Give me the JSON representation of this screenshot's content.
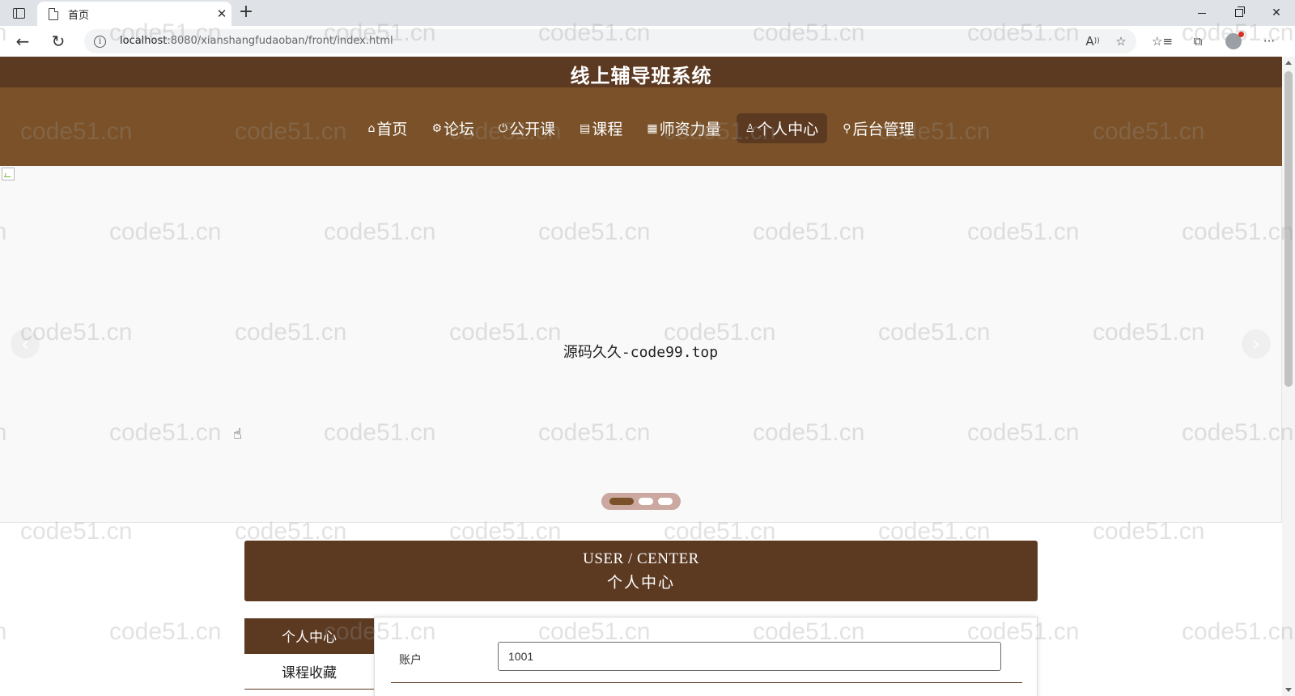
{
  "browser": {
    "tab_title": "首页",
    "url_host": "localhost",
    "url_rest": ":8080/xianshangfudaoban/front/index.html"
  },
  "site": {
    "title": "线上辅导班系统",
    "nav": [
      {
        "label": "首页",
        "icon": "home-icon",
        "glyph": "⌂",
        "active": false
      },
      {
        "label": "论坛",
        "icon": "forum-icon",
        "glyph": "⚙",
        "active": false
      },
      {
        "label": "公开课",
        "icon": "power-icon",
        "glyph": "⏻",
        "active": false
      },
      {
        "label": "课程",
        "icon": "clipboard-icon",
        "glyph": "▤",
        "active": false
      },
      {
        "label": "师资力量",
        "icon": "calendar-icon",
        "glyph": "▦",
        "active": false
      },
      {
        "label": "个人中心",
        "icon": "user-icon",
        "glyph": "♙",
        "active": true
      },
      {
        "label": "后台管理",
        "icon": "link-icon",
        "glyph": "⚲",
        "active": false
      }
    ]
  },
  "carousel": {
    "caption": "源码久久-code99.top",
    "active_index": 0,
    "slide_count": 3
  },
  "user_center": {
    "title_en": "USER / CENTER",
    "title_cn": "个人中心"
  },
  "side_menu": [
    {
      "label": "个人中心",
      "active": true
    },
    {
      "label": "课程收藏",
      "active": false
    }
  ],
  "form": {
    "account_label": "账户",
    "account_value": "1001"
  },
  "watermark": "code51.cn",
  "colors": {
    "header": "#5c3a22",
    "nav_bar": "#7a5128",
    "indicator": "#cba8a0"
  }
}
